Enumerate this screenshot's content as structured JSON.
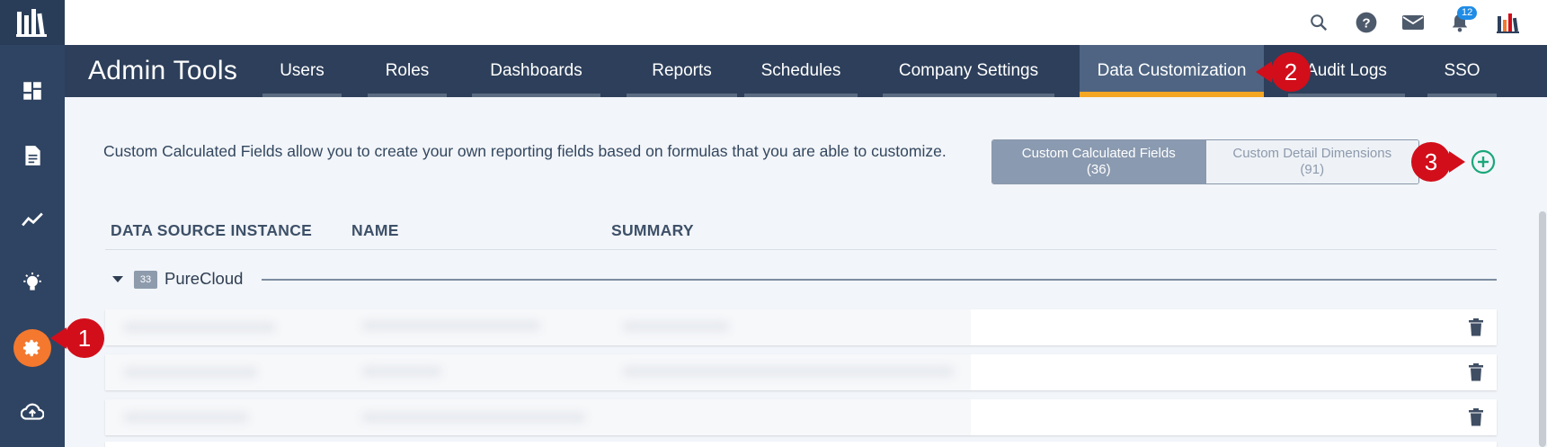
{
  "topbar": {
    "icons": [
      "search-icon",
      "help-icon",
      "mail-icon",
      "bell-icon",
      "app-logo-icon"
    ],
    "notification_count": "12"
  },
  "sidebar": {
    "items": [
      "dashboard-icon",
      "document-icon",
      "trend-icon",
      "lightbulb-icon",
      "gear-icon",
      "cloud-upload-icon"
    ],
    "active": "gear-icon",
    "accent": "#f4782d"
  },
  "admin": {
    "title": "Admin Tools",
    "tabs": [
      {
        "label": "Users"
      },
      {
        "label": "Roles"
      },
      {
        "label": "Dashboards"
      },
      {
        "label": "Reports"
      },
      {
        "label": "Schedules"
      },
      {
        "label": "Company Settings"
      },
      {
        "label": "Data Customization"
      },
      {
        "label": "Audit Logs"
      },
      {
        "label": "SSO"
      }
    ],
    "active_tab": "Data Customization",
    "active_color": "#f5a623"
  },
  "content": {
    "description": "Custom Calculated Fields allow you to create your own reporting fields based on formulas that you are able to customize.",
    "toggle": {
      "calculated_label": "Custom Calculated Fields",
      "calculated_count": "(36)",
      "dimensions_label": "Custom Detail Dimensions",
      "dimensions_count": "(91)"
    },
    "columns": [
      "DATA SOURCE INSTANCE",
      "NAME",
      "SUMMARY"
    ],
    "group": {
      "count": "33",
      "label": "PureCloud"
    }
  },
  "callouts": [
    "1",
    "2",
    "3"
  ],
  "colors": {
    "callout": "#d20e1b",
    "add": "#1aa77a"
  }
}
